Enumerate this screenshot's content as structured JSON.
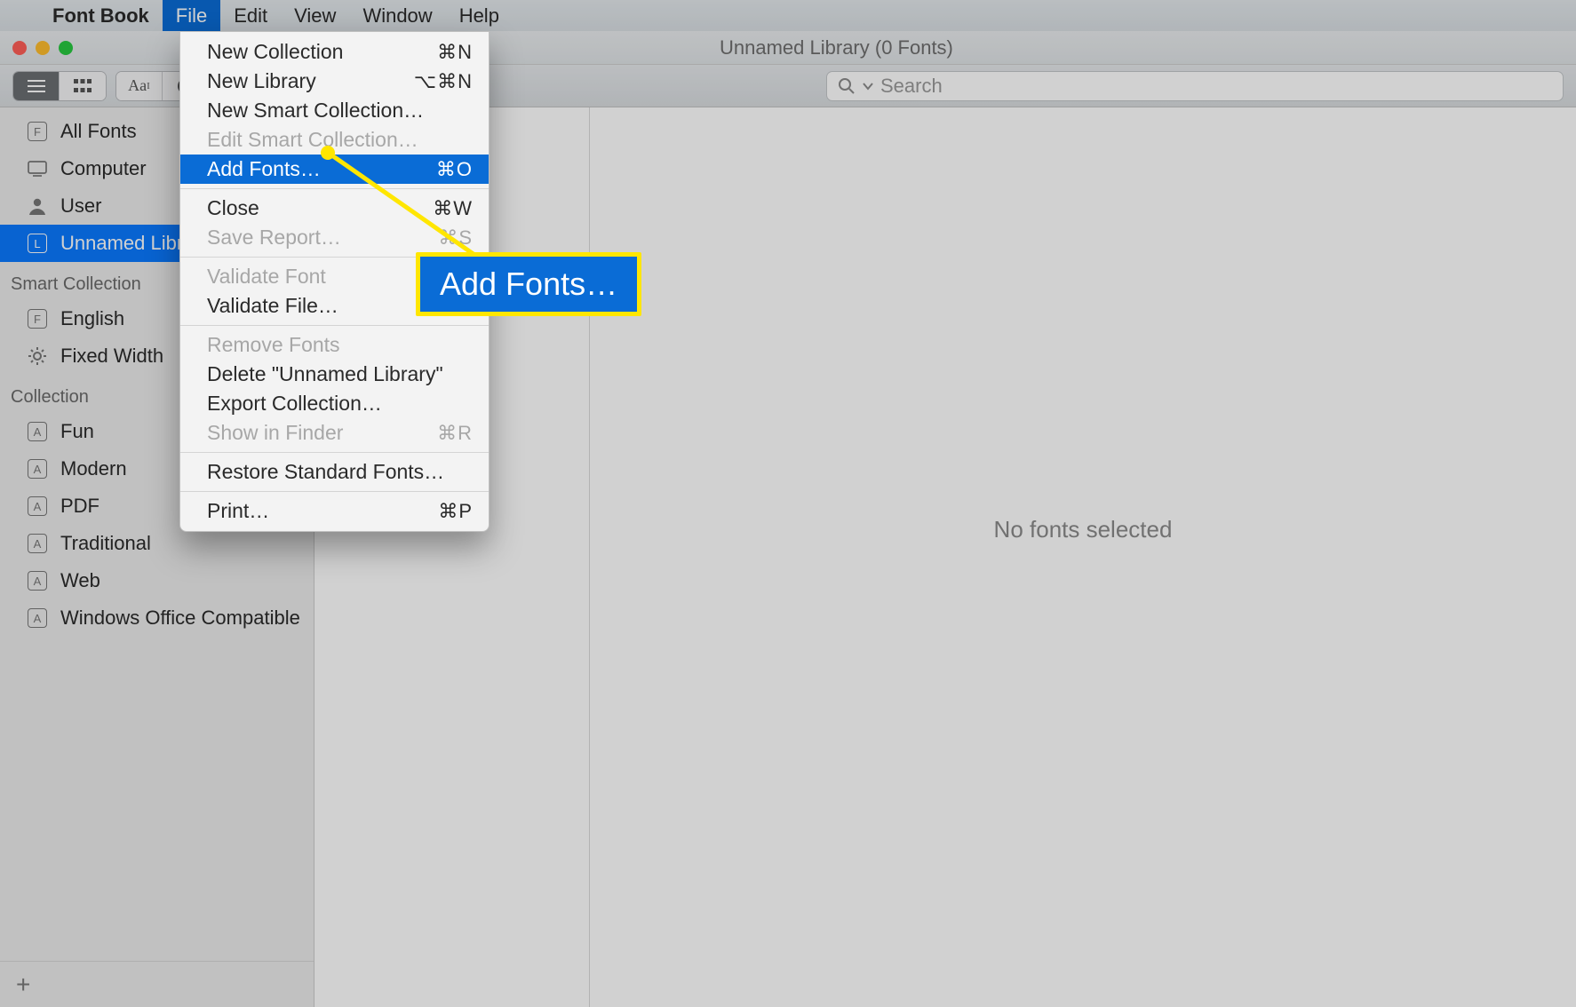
{
  "menubar": {
    "app_name": "Font Book",
    "items": [
      "File",
      "Edit",
      "View",
      "Window",
      "Help"
    ],
    "active_index": 0
  },
  "window": {
    "title": "Unnamed Library (0 Fonts)"
  },
  "toolbar": {
    "search_placeholder": "Search"
  },
  "sidebar": {
    "top_items": [
      {
        "label": "All Fonts",
        "icon": "F"
      },
      {
        "label": "Computer",
        "icon": "monitor"
      },
      {
        "label": "User",
        "icon": "person"
      },
      {
        "label": "Unnamed Library",
        "icon": "L",
        "selected": true
      }
    ],
    "smart_header": "Smart Collection",
    "smart_items": [
      {
        "label": "English",
        "icon": "F"
      },
      {
        "label": "Fixed Width",
        "icon": "gear"
      }
    ],
    "collection_header": "Collection",
    "collection_items": [
      {
        "label": "Fun"
      },
      {
        "label": "Modern"
      },
      {
        "label": "PDF"
      },
      {
        "label": "Traditional"
      },
      {
        "label": "Web"
      },
      {
        "label": "Windows Office Compatible"
      }
    ]
  },
  "preview": {
    "empty_text": "No fonts selected"
  },
  "dropdown": {
    "groups": [
      [
        {
          "label": "New Collection",
          "shortcut": "⌘N"
        },
        {
          "label": "New Library",
          "shortcut": "⌥⌘N"
        },
        {
          "label": "New Smart Collection…",
          "shortcut": ""
        },
        {
          "label": "Edit Smart Collection…",
          "shortcut": "",
          "disabled": true
        },
        {
          "label": "Add Fonts…",
          "shortcut": "⌘O",
          "highlight": true
        }
      ],
      [
        {
          "label": "Close",
          "shortcut": "⌘W"
        },
        {
          "label": "Save Report…",
          "shortcut": "⌘S",
          "disabled": true
        }
      ],
      [
        {
          "label": "Validate Font",
          "shortcut": "",
          "disabled": true
        },
        {
          "label": "Validate File…",
          "shortcut": ""
        }
      ],
      [
        {
          "label": "Remove Fonts",
          "shortcut": "",
          "disabled": true
        },
        {
          "label": "Delete \"Unnamed Library\"",
          "shortcut": ""
        },
        {
          "label": "Export Collection…",
          "shortcut": ""
        },
        {
          "label": "Show in Finder",
          "shortcut": "⌘R",
          "disabled": true
        }
      ],
      [
        {
          "label": "Restore Standard Fonts…",
          "shortcut": ""
        }
      ],
      [
        {
          "label": "Print…",
          "shortcut": "⌘P"
        }
      ]
    ]
  },
  "callout": {
    "text": "Add Fonts…"
  }
}
